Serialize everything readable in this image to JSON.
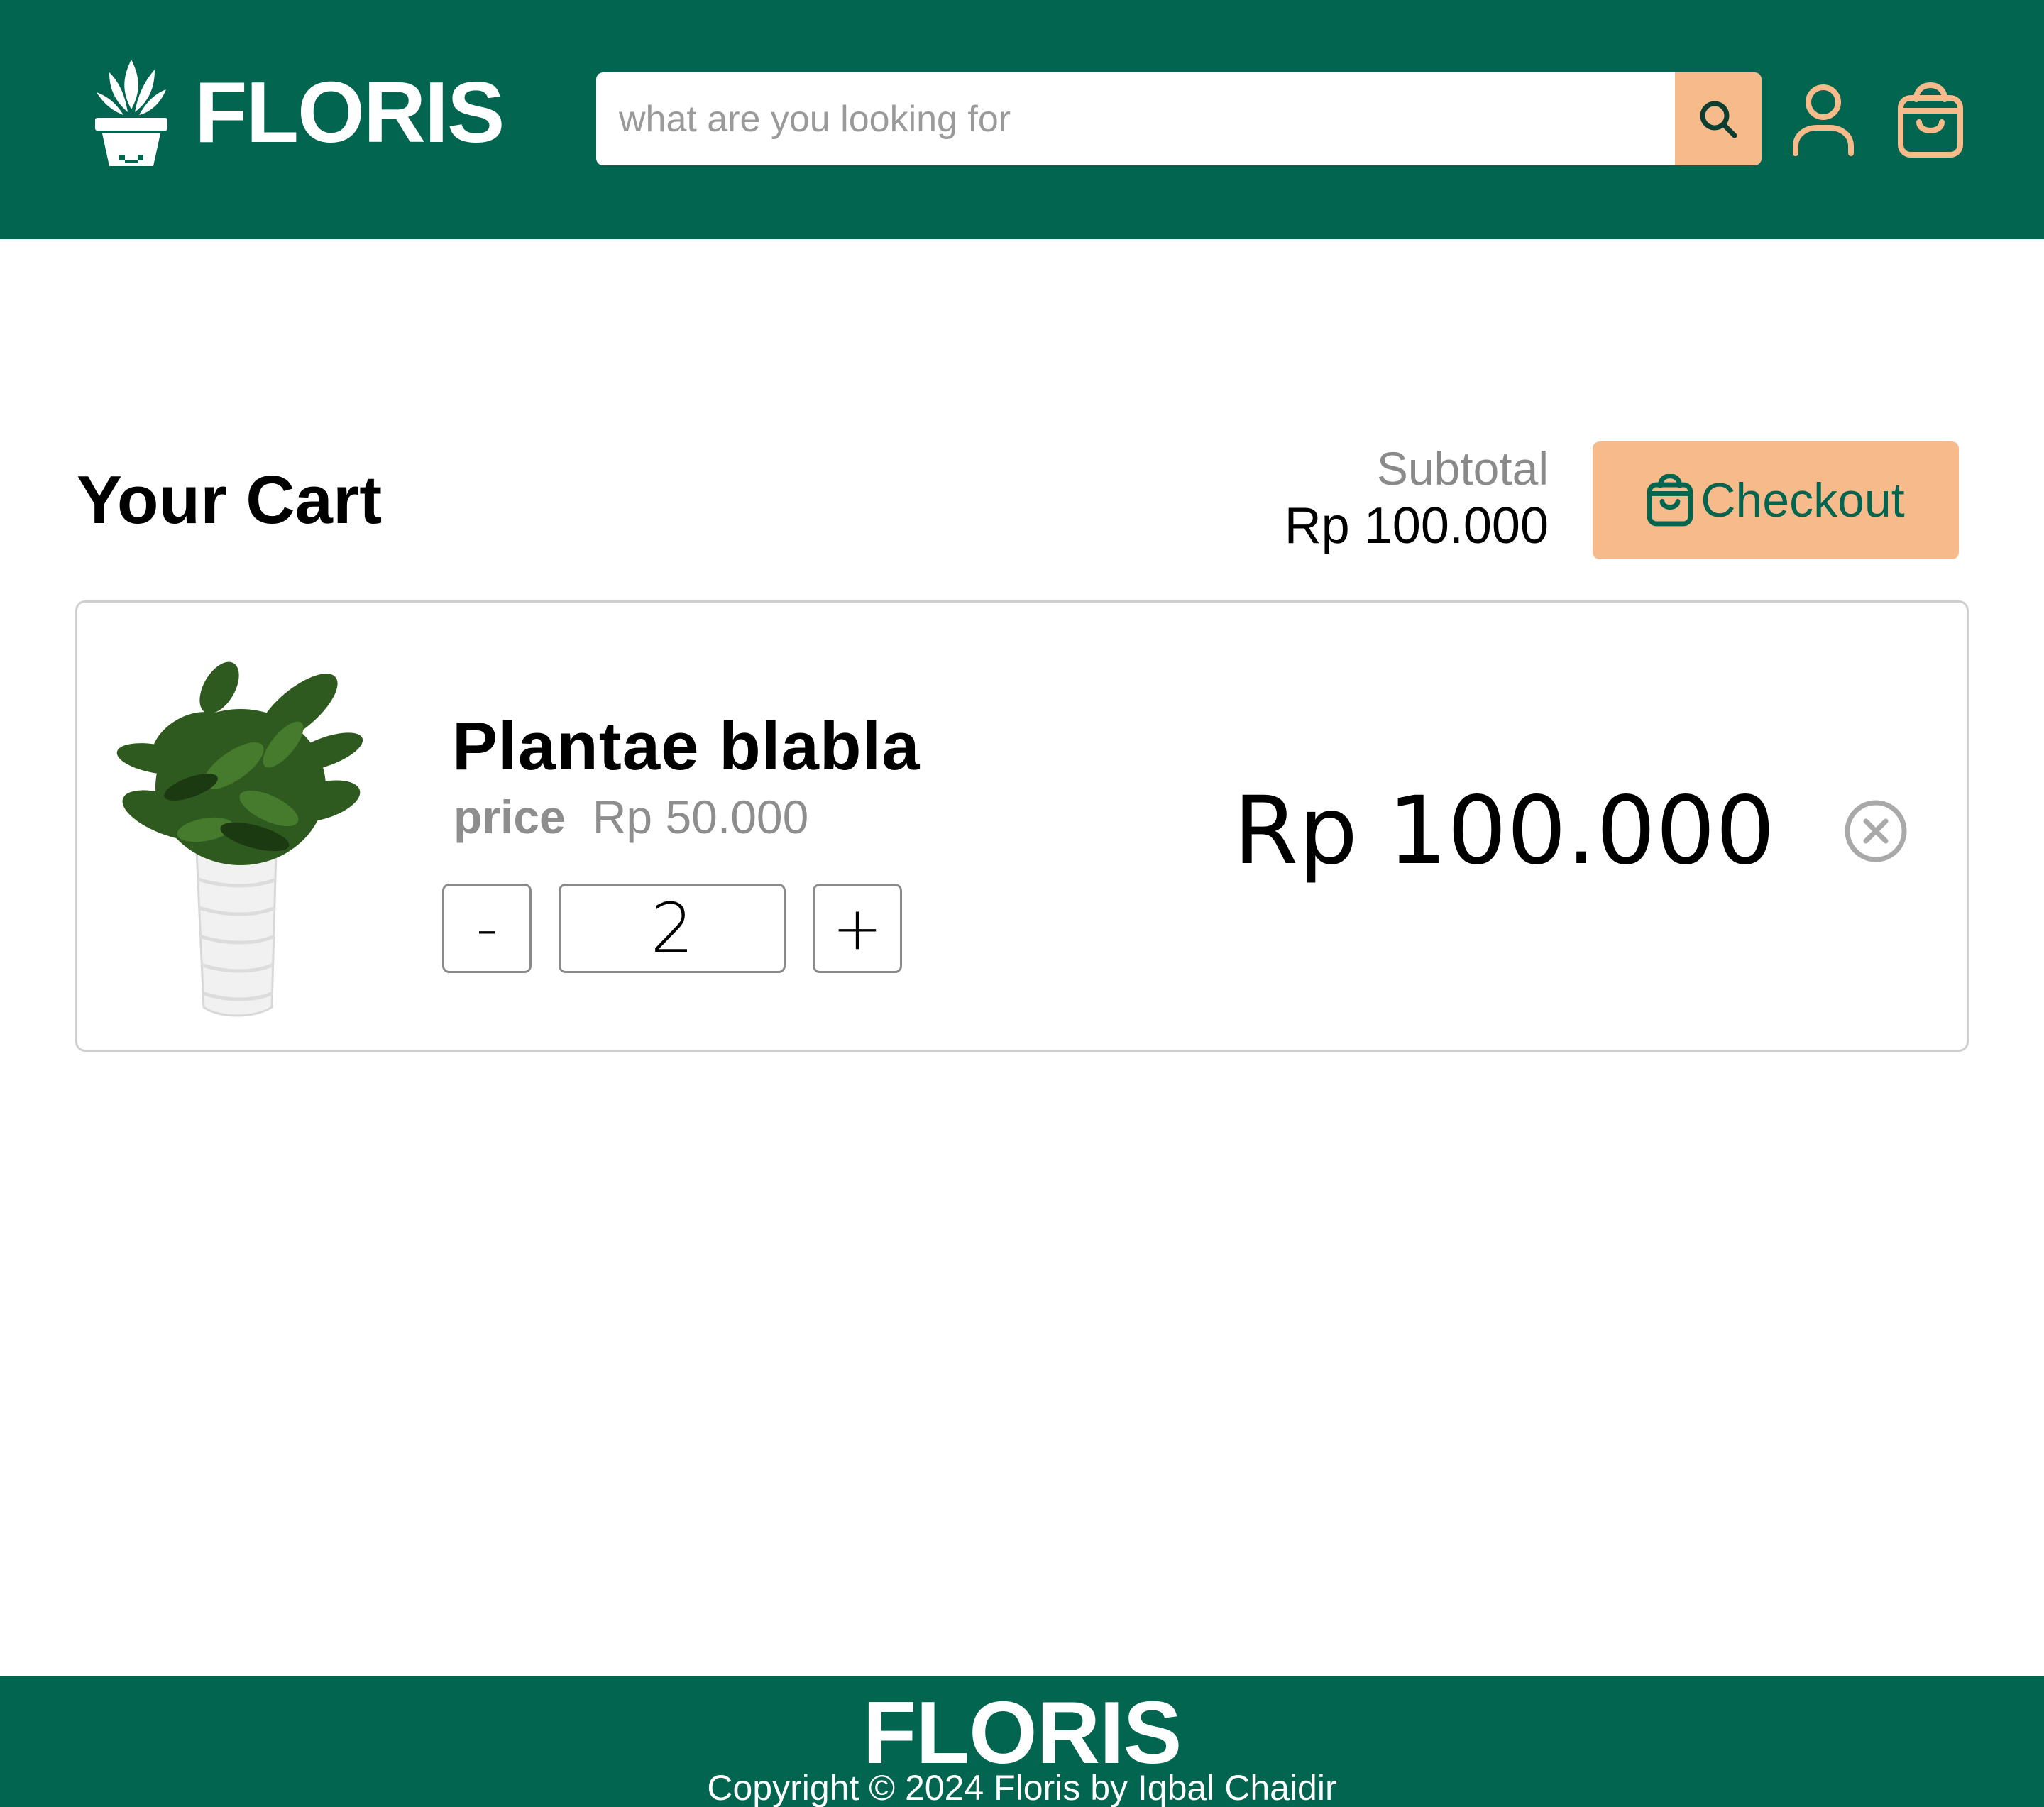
{
  "header": {
    "brand": "FLORIS",
    "search_placeholder": "what are you looking for",
    "icons": [
      "plant-pot-logo-icon",
      "search-icon",
      "user-icon",
      "shopping-bag-icon"
    ]
  },
  "cart": {
    "title": "Your Cart",
    "subtotal_label": "Subtotal",
    "subtotal_value": "Rp 100.000",
    "checkout_label": "Checkout",
    "items": [
      {
        "name": "Plantae blabla",
        "price_label": "price",
        "price_value": "Rp 50.000",
        "quantity": "2",
        "minus_label": "-",
        "plus_label": "+",
        "line_total": "Rp 100.000",
        "image": "potted-plant-white-vase"
      }
    ]
  },
  "footer": {
    "brand": "FLORIS",
    "copyright": "Copyright © 2024 Floris by Iqbal Chaidir"
  },
  "colors": {
    "primary_green": "#01654f",
    "accent_peach": "#f7bb8b",
    "muted_gray": "#8e8e8e",
    "border_gray": "#cfcfcf"
  }
}
